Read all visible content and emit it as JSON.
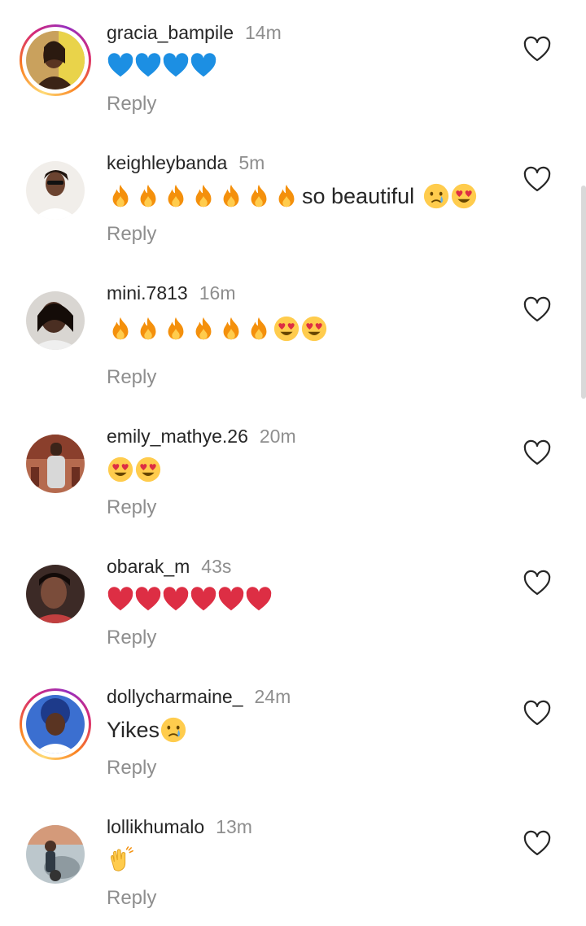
{
  "comments": [
    {
      "username": "gracia_bampile",
      "time": "14m",
      "text": "",
      "reply": "Reply",
      "avatar_story": true,
      "emoji": [
        "blue-heart",
        "blue-heart",
        "blue-heart",
        "blue-heart"
      ]
    },
    {
      "username": "keighleybanda",
      "time": "5m",
      "text": "so beautiful",
      "reply": "Reply",
      "avatar_story": false,
      "emoji": [
        "fire",
        "fire",
        "fire",
        "fire",
        "fire",
        "fire",
        "fire"
      ],
      "emoji_after": [
        "crying-face",
        "heart-eyes"
      ]
    },
    {
      "username": "mini.7813",
      "time": "16m",
      "text": "",
      "reply": "Reply",
      "avatar_story": false,
      "emoji": [
        "fire",
        "fire",
        "fire",
        "fire",
        "fire",
        "fire",
        "heart-eyes",
        "heart-eyes"
      ]
    },
    {
      "username": "emily_mathye.26",
      "time": "20m",
      "text": "",
      "reply": "Reply",
      "avatar_story": false,
      "emoji": [
        "heart-eyes",
        "heart-eyes"
      ]
    },
    {
      "username": "obarak_m",
      "time": "43s",
      "text": "",
      "reply": "Reply",
      "avatar_story": false,
      "emoji": [
        "red-heart",
        "red-heart",
        "red-heart",
        "red-heart",
        "red-heart",
        "red-heart"
      ]
    },
    {
      "username": "dollycharmaine_",
      "time": "24m",
      "text": "Yikes",
      "reply": "Reply",
      "avatar_story": true,
      "emoji": [],
      "emoji_after": [
        "crying-face"
      ]
    },
    {
      "username": "lollikhumalo",
      "time": "13m",
      "text": "",
      "reply": "Reply",
      "avatar_story": false,
      "emoji": [
        "clapping-hands"
      ]
    }
  ],
  "icons": {
    "like": "heart-outline-icon"
  },
  "colors": {
    "username": "#262626",
    "meta": "#8e8e8e",
    "heart_outline": "#262626"
  }
}
